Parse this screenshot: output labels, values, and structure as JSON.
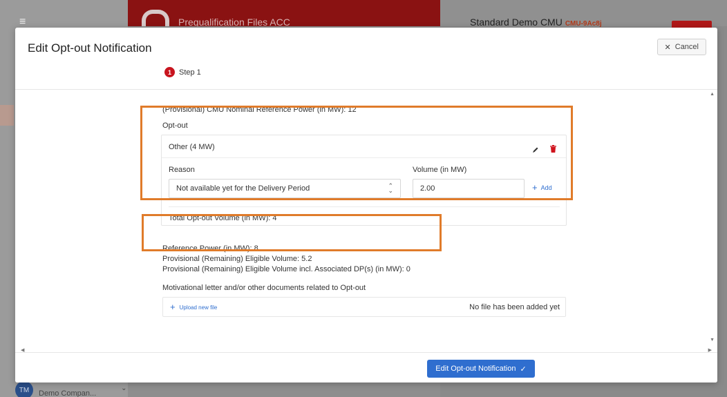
{
  "background": {
    "app_title": "Prequalification Files ACC",
    "cmu_name": "Standard Demo CMU",
    "cmu_id": "CMU-9Ac8j",
    "user_initials": "TM",
    "company": "Demo Compan..."
  },
  "modal": {
    "title": "Edit Opt-out Notification",
    "cancel_label": "Cancel",
    "step_number": "1",
    "step_label": "Step 1"
  },
  "form": {
    "nominal_power": "(Provisional) CMU Nominal Reference Power (in MW):  12",
    "optout_label": "Opt-out",
    "optout_item_title": "Other (4 MW)",
    "reason_label": "Reason",
    "reason_value": "Not available yet for the Delivery Period",
    "volume_label": "Volume (in MW)",
    "volume_value": "2.00",
    "add_label": "Add",
    "total_optout": "Total Opt-out Volume (in MW): 4",
    "reference_power": "Reference Power (in MW): 8",
    "remaining_eligible": "Provisional (Remaining) Eligible Volume: 5.2",
    "remaining_eligible_dp": "Provisional (Remaining) Eligible Volume incl. Associated DP(s) (in MW): 0",
    "motivational_label": "Motivational letter and/or other documents related to Opt-out",
    "upload_label": "Upload new file",
    "no_file_text": "No file has been added yet"
  },
  "footer": {
    "submit_label": "Edit Opt-out Notification"
  },
  "colors": {
    "primary": "#2f6ecf",
    "danger": "#c8141e",
    "highlight": "#e07b2a"
  }
}
